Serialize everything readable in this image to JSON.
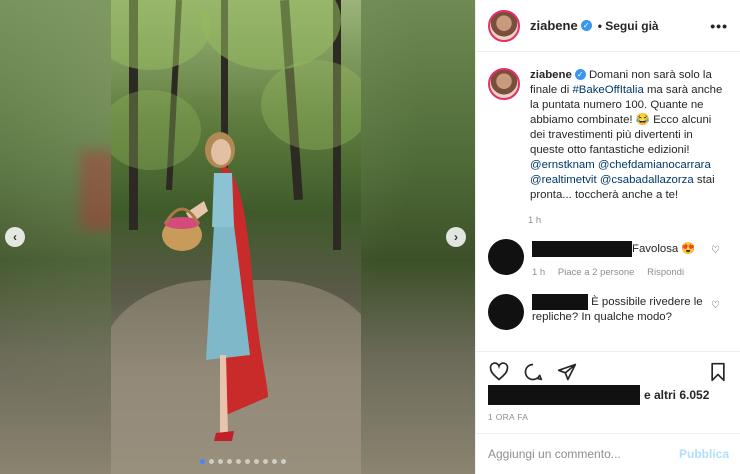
{
  "post": {
    "username": "ziabene",
    "follow_label": "Segui già",
    "more_label": "•••",
    "caption_user": "ziabene",
    "caption_parts": {
      "p1": " Domani non sarà solo la finale di ",
      "hashtag": "#BakeOffItalia",
      "p2": " ma sarà anche la puntata numero 100. Quante ne abbiamo combinate! 😂 Ecco alcuni dei travestimenti più divertenti in queste otto fantastiche edizioni! ",
      "m1": "@ernstknam",
      "m2": "@chefdamianocarrara",
      "m3": "@realtimetvit",
      "m4": "@csabadallazorza",
      "p3": " stai pronta... toccherà anche a te!"
    },
    "caption_time": "1 h"
  },
  "comments": [
    {
      "text": "Favolosa 😍",
      "meta_time": "1 h",
      "meta_likes": "Piace a 2 persone",
      "meta_reply": "Rispondi"
    },
    {
      "text": "È possibile rivedere le repliche? In qualche modo?"
    }
  ],
  "likes_suffix": "e altri 6.052",
  "posted_ago": "1 ORA FA",
  "composer": {
    "placeholder": "Aggiungi un commento...",
    "publish_label": "Pubblica"
  },
  "icons": {
    "prev": "chevron-left-icon",
    "next": "chevron-right-icon",
    "like": "heart-icon",
    "comment": "comment-icon",
    "share": "share-icon",
    "save": "bookmark-icon"
  },
  "carousel": {
    "total_slides": 10,
    "active_slide": 1
  },
  "colors": {
    "accent": "#3897f0",
    "link": "#00376b",
    "publish": "#b2dffc"
  }
}
